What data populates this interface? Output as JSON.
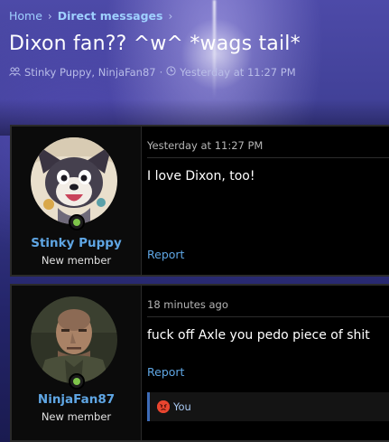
{
  "breadcrumb": {
    "home": "Home",
    "current": "Direct messages",
    "sep": "›"
  },
  "conversation": {
    "title": "Dixon fan?? ^w^ *wags tail*",
    "participants": "Stinky Puppy, NinjaFan87",
    "meta_sep": "·",
    "timestamp": "Yesterday at 11:27 PM"
  },
  "messages": [
    {
      "username": "Stinky Puppy",
      "user_title": "New member",
      "timestamp": "Yesterday at 11:27 PM",
      "text": "I love Dixon, too!",
      "report_label": "Report"
    },
    {
      "username": "NinjaFan87",
      "user_title": "New member",
      "timestamp": "18 minutes ago",
      "text": "fuck off Axle you pedo piece of shit",
      "report_label": "Report",
      "reaction": {
        "emoji": "angry-face-icon",
        "label": "You"
      }
    }
  ],
  "colors": {
    "link": "#5fa6e4",
    "online": "#7ec44a",
    "background": "#000000"
  }
}
